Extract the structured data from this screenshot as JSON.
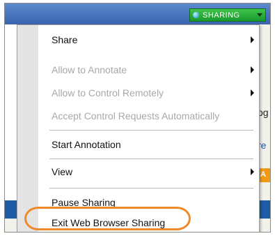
{
  "sharing_indicator": {
    "label": "SHARING",
    "dot_icon": "globe-icon",
    "dropdown_icon": "chevron-down-icon",
    "color": "#1a9a2d"
  },
  "background": {
    "text_1": "og",
    "text_2": "re",
    "chip_text": "A"
  },
  "menu": {
    "items": [
      {
        "label": "Share",
        "enabled": true,
        "submenu": true
      },
      {
        "label": "Allow to Annotate",
        "enabled": false,
        "submenu": true
      },
      {
        "label": "Allow to Control Remotely",
        "enabled": false,
        "submenu": true
      },
      {
        "label": "Accept Control Requests Automatically",
        "enabled": false,
        "submenu": false
      },
      {
        "label": "Start Annotation",
        "enabled": true,
        "submenu": false
      },
      {
        "label": "View",
        "enabled": true,
        "submenu": true
      },
      {
        "label": "Pause Sharing",
        "enabled": true,
        "submenu": false
      },
      {
        "label": "Exit Web Browser Sharing",
        "enabled": true,
        "submenu": false,
        "highlighted": true
      }
    ]
  },
  "highlight_color": "#ee8a2c"
}
